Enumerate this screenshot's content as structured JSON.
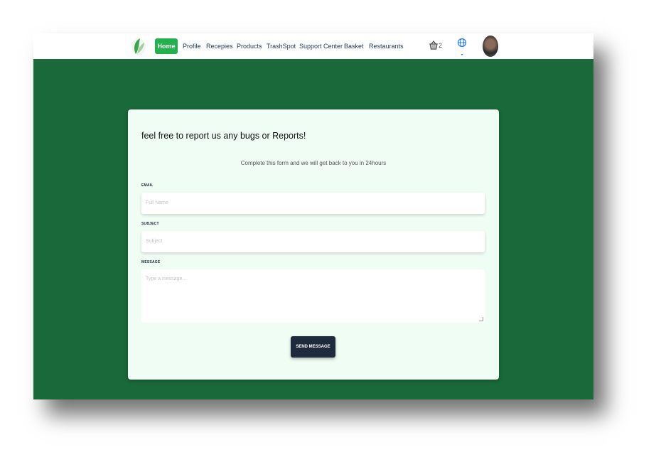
{
  "nav": {
    "items": [
      {
        "label": "Home",
        "active": true
      },
      {
        "label": "Profile"
      },
      {
        "label": "Recepies"
      },
      {
        "label": "Products"
      },
      {
        "label": "TrashSpot"
      },
      {
        "label": "Support Center"
      },
      {
        "label": "Basket"
      },
      {
        "label": "Restaurants"
      }
    ],
    "basket_count": "2",
    "icons": [
      "leaf-logo-icon",
      "basket-icon",
      "globe-icon",
      "avatar"
    ]
  },
  "form": {
    "title": "feel free to report us any bugs or Reports!",
    "subtitle": "Complete this form and we will get back to you in 24hours",
    "email_label": "EMAIL",
    "email_placeholder": "Full Name",
    "subject_label": "SUBJECT",
    "subject_placeholder": "Subject",
    "message_label": "MESSAGE",
    "message_placeholder": "Type a message...",
    "send_label": "SEND MESSAGE"
  },
  "colors": {
    "background": "#19693a",
    "home_active": "#22b14c",
    "card": "#effdf4",
    "button": "#1f2a3c"
  }
}
